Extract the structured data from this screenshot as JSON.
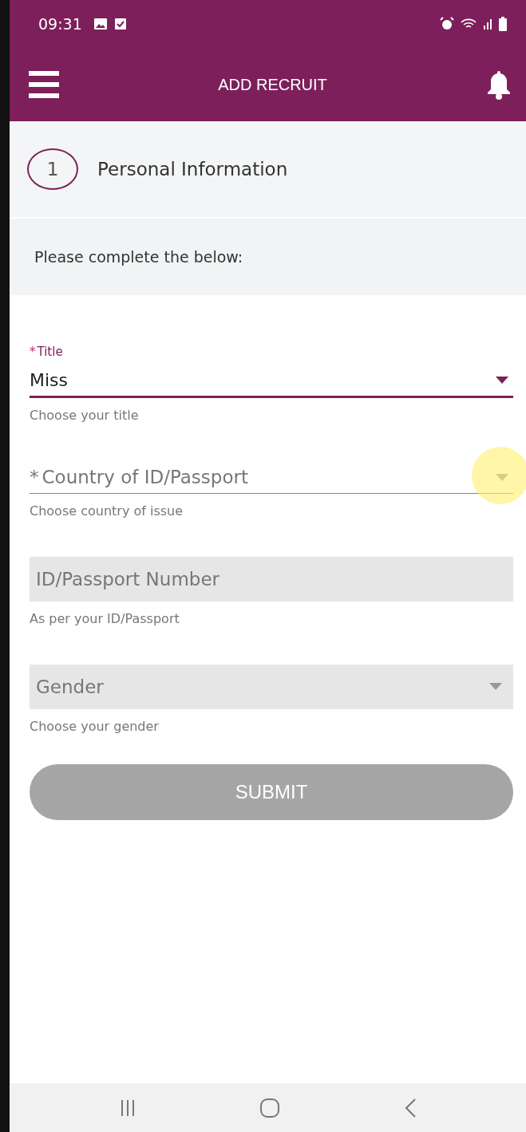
{
  "status_bar": {
    "time": "09:31"
  },
  "header": {
    "title": "ADD RECRUIT"
  },
  "step": {
    "number": "1",
    "title": "Personal Information"
  },
  "instruction": "Please complete the below:",
  "fields": [
    {
      "kind": "select",
      "mark": "*",
      "label": "Title",
      "value": "Miss",
      "helper": "Choose your title",
      "focused": true
    },
    {
      "kind": "select",
      "mark": "*",
      "placeholder": "Country of ID/Passport",
      "helper": "Choose country of issue",
      "focused": false,
      "touched": true
    },
    {
      "kind": "textbox",
      "placeholder": "ID/Passport Number",
      "helper": "As per your ID/Passport",
      "focused": false
    },
    {
      "kind": "combo",
      "placeholder": "Gender",
      "helper": "Choose your gender",
      "focused": false
    }
  ],
  "submit": {
    "label": "SUBMIT",
    "disabled": true
  }
}
